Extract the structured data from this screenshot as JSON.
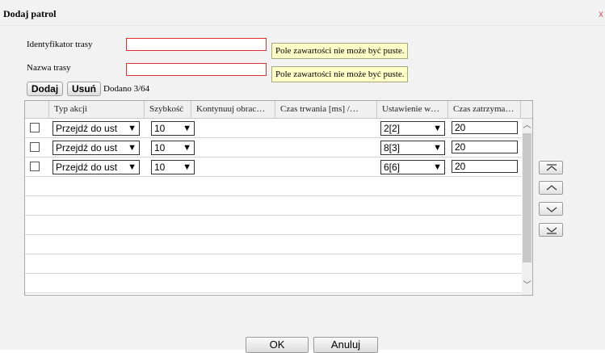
{
  "dialog": {
    "title": "Dodaj patrol",
    "close_glyph": "x"
  },
  "form": {
    "route_id_label": "Identyfikator trasy",
    "route_id_value": "",
    "route_id_error": "Pole zawartości nie może być puste.",
    "route_name_label": "Nazwa trasy",
    "route_name_value": "",
    "route_name_error": "Pole zawartości nie może być puste."
  },
  "toolbar": {
    "add_label": "Dodaj",
    "remove_label": "Usuń",
    "added_count": "Dodano 3/64"
  },
  "table": {
    "headers": [
      "Typ akcji",
      "Szybkość",
      "Kontynuuj obrac…",
      "Czas trwania [ms] /…",
      "Ustawienie w…",
      "Czas zatrzyma…"
    ],
    "rows": [
      {
        "checked": false,
        "action": "Przejdź do ust",
        "speed": "10",
        "preset": "2[2]",
        "dwell": "20"
      },
      {
        "checked": false,
        "action": "Przejdź do ust",
        "speed": "10",
        "preset": "8[3]",
        "dwell": "20"
      },
      {
        "checked": false,
        "action": "Przejdź do ust",
        "speed": "10",
        "preset": "6[6]",
        "dwell": "20"
      }
    ]
  },
  "side_buttons": [
    "move-top-icon",
    "move-up-icon",
    "move-down-icon",
    "move-bottom-icon"
  ],
  "footer": {
    "ok_label": "OK",
    "cancel_label": "Anuluj"
  }
}
